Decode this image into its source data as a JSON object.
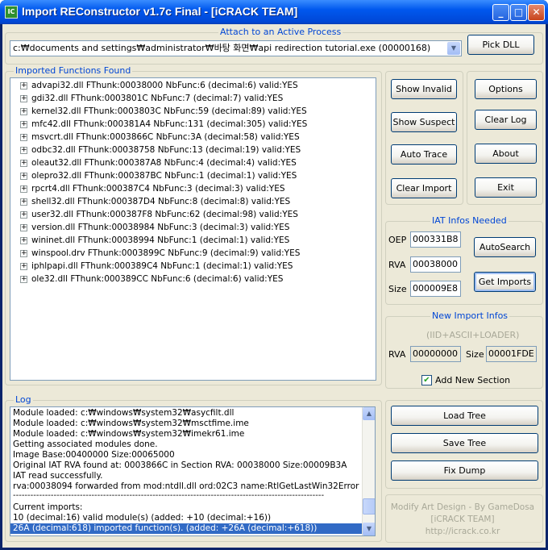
{
  "window": {
    "title": "Import REConstructor v1.7c Final - [iCRACK TEAM]",
    "icon_label": "IC",
    "minimize_glyph": "_",
    "maximize_glyph": "□",
    "close_glyph": "✕"
  },
  "attach": {
    "group_title": "Attach to an Active Process",
    "process_value": "c:₩documents and settings₩administrator₩바탕 화면₩api redirection tutorial.exe (00000168)",
    "pick_dll_label": "Pick DLL"
  },
  "imports": {
    "group_title": "Imported Functions Found",
    "items": [
      "advapi32.dll FThunk:00038000 NbFunc:6 (decimal:6) valid:YES",
      "gdi32.dll FThunk:0003801C NbFunc:7 (decimal:7) valid:YES",
      "kernel32.dll FThunk:0003803C NbFunc:59 (decimal:89) valid:YES",
      "mfc42.dll FThunk:000381A4 NbFunc:131 (decimal:305) valid:YES",
      "msvcrt.dll FThunk:0003866C NbFunc:3A (decimal:58) valid:YES",
      "odbc32.dll FThunk:00038758 NbFunc:13 (decimal:19) valid:YES",
      "oleaut32.dll FThunk:000387A8 NbFunc:4 (decimal:4) valid:YES",
      "olepro32.dll FThunk:000387BC NbFunc:1 (decimal:1) valid:YES",
      "rpcrt4.dll FThunk:000387C4 NbFunc:3 (decimal:3) valid:YES",
      "shell32.dll FThunk:000387D4 NbFunc:8 (decimal:8) valid:YES",
      "user32.dll FThunk:000387F8 NbFunc:62 (decimal:98) valid:YES",
      "version.dll FThunk:00038984 NbFunc:3 (decimal:3) valid:YES",
      "wininet.dll FThunk:00038994 NbFunc:1 (decimal:1) valid:YES",
      "winspool.drv FThunk:0003899C NbFunc:9 (decimal:9) valid:YES",
      "iphlpapi.dll FThunk:000389C4 NbFunc:1 (decimal:1) valid:YES",
      "ole32.dll FThunk:000389CC NbFunc:6 (decimal:6) valid:YES"
    ]
  },
  "buttons": {
    "show_invalid": "Show Invalid",
    "show_suspect": "Show Suspect",
    "auto_trace": "Auto Trace",
    "clear_import": "Clear Import",
    "options": "Options",
    "clear_log": "Clear Log",
    "about": "About",
    "exit": "Exit"
  },
  "iat": {
    "group_title": "IAT Infos Needed",
    "oep_label": "OEP",
    "oep_value": "000331B8",
    "rva_label": "RVA",
    "rva_value": "00038000",
    "size_label": "Size",
    "size_value": "000009E8",
    "autosearch_label": "AutoSearch",
    "get_imports_label": "Get Imports"
  },
  "new_import": {
    "group_title": "New Import Infos",
    "subtitle": "(IID+ASCII+LOADER)",
    "rva_label": "RVA",
    "rva_value": "00000000",
    "size_label": "Size",
    "size_value": "00001FDE",
    "add_section_label": "Add New Section",
    "add_section_checked": true
  },
  "log": {
    "group_title": "Log",
    "lines": [
      "Module loaded: c:₩windows₩system32₩asycfilt.dll",
      "Module loaded: c:₩windows₩system32₩msctfime.ime",
      "Module loaded: c:₩windows₩system32₩imekr61.ime",
      "Getting associated modules done.",
      "Image Base:00400000 Size:00065000",
      "Original IAT RVA found at: 0003866C in Section RVA: 00038000 Size:00009B3A",
      "IAT read successfully.",
      "rva:00038094 forwarded from mod:ntdll.dll ord:02C3 name:RtlGetLastWin32Error"
    ],
    "separator": "-----------------------------------------------------------------------------------------------------------",
    "tail_lines": [
      "Current imports:",
      "10 (decimal:16) valid module(s) (added: +10 (decimal:+16))"
    ],
    "selected_line": "26A (decimal:618) imported function(s). (added: +26A (decimal:+618))"
  },
  "tree_actions": {
    "load_tree": "Load Tree",
    "save_tree": "Save Tree",
    "fix_dump": "Fix Dump"
  },
  "credits": {
    "line1": "Modify Art Design - By GameDosa",
    "line2": "[iCRACK TEAM]",
    "line3": "http://icrack.co.kr"
  }
}
